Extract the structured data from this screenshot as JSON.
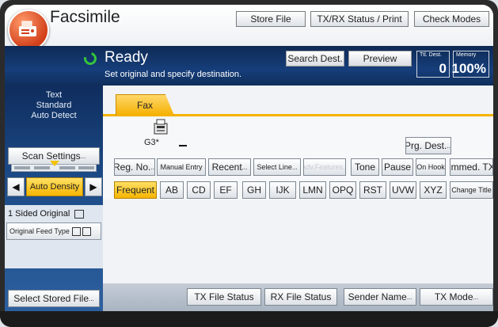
{
  "app": {
    "title": "Facsimile"
  },
  "top_buttons": {
    "store_file": "Store File",
    "txrx_status": "TX/RX Status / Print",
    "check_modes": "Check Modes"
  },
  "status": {
    "state": "Ready",
    "message": "Set original and specify destination.",
    "search_dest": "Search Dest.",
    "preview": "Preview",
    "ttl_dest_label": "Ttl. Dest.",
    "ttl_dest_value": "0",
    "memory_label": "Memory",
    "memory_value": "100%"
  },
  "left_panel": {
    "mode_lines": [
      "Text",
      "Standard",
      "Auto Detect"
    ],
    "scan_settings": "Scan Settings",
    "auto_density": "Auto Density",
    "sided_original": "1 Sided Original",
    "original_feed_type": "Original Feed Type",
    "select_stored_file": "Select Stored File"
  },
  "main": {
    "tab": "Fax",
    "line_label": "G3*",
    "prg_dest": "Prg. Dest.",
    "row1": [
      "Reg. No.",
      "Manual Entry",
      "Recent",
      "Select Line",
      "Adv.Features",
      "Tone",
      "Pause",
      "On Hook",
      "Immed. TX"
    ],
    "row2": [
      "Frequent",
      "AB",
      "CD",
      "EF",
      "GH",
      "IJK",
      "LMN",
      "OPQ",
      "RST",
      "UVW",
      "XYZ",
      "Change Title"
    ],
    "bottom": [
      "TX File Status",
      "RX File Status",
      "Sender Name",
      "TX Mode"
    ]
  },
  "icons": {
    "fax_app": "fax-machine-icon",
    "line_machine": "fax-line-icon"
  },
  "colors": {
    "status_bg": "#163e7a",
    "accent": "#f5b400",
    "ready_indicator": "#33c43c"
  }
}
